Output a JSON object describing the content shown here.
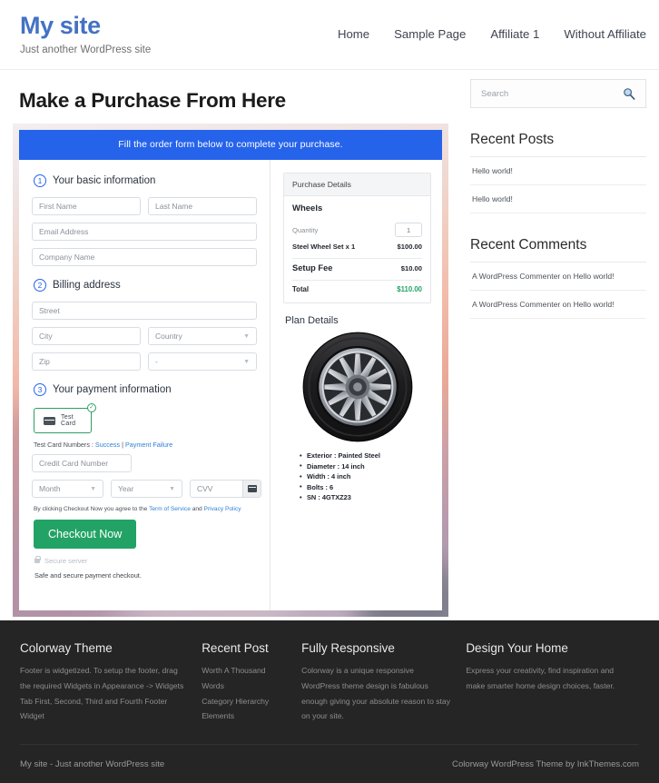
{
  "header": {
    "site_title": "My site",
    "tagline": "Just another WordPress site",
    "nav": [
      {
        "label": "Home"
      },
      {
        "label": "Sample Page"
      },
      {
        "label": "Affiliate 1"
      },
      {
        "label": "Without Affiliate"
      }
    ]
  },
  "main": {
    "page_title": "Make a Purchase From Here",
    "banner": "Fill the order form below to complete your purchase.",
    "steps": {
      "step1_num": "1",
      "step1_label": "Your basic information",
      "step2_num": "2",
      "step2_label": "Billing address",
      "step3_num": "3",
      "step3_label": "Your payment information"
    },
    "fields": {
      "first_name": "First Name",
      "last_name": "Last Name",
      "email": "Email Address",
      "company": "Company Name",
      "street": "Street",
      "city": "City",
      "country": "Country",
      "zip": "Zip",
      "state": "-",
      "card_number": "Credit Card Number",
      "month": "Month",
      "year": "Year",
      "cvv": "CVV"
    },
    "payment": {
      "tile_label": "Test Card",
      "tile_check": "✓",
      "testcard_prefix": "Test Card Numbers : ",
      "testcard_success": "Success",
      "testcard_divider": " | ",
      "testcard_failure": "Payment Failure",
      "agree_prefix": "By clicking Checkout Now you agree to the ",
      "agree_tos": "Term of Service",
      "agree_and": " and ",
      "agree_privacy": "Privacy Policy",
      "checkout_button": "Checkout Now",
      "secure_server": "Secure server",
      "safe_note": "Safe and secure payment checkout."
    },
    "purchase_details": {
      "heading": "Purchase Details",
      "product": "Wheels",
      "quantity_label": "Quantity",
      "quantity_value": "1",
      "item_label": "Steel Wheel Set x 1",
      "item_price": "$100.00",
      "setup_label": "Setup Fee",
      "setup_price": "$10.00",
      "total_label": "Total",
      "total_price": "$110.00",
      "total_color": "#22a365"
    },
    "plan": {
      "title": "Plan Details",
      "image_name": "car-wheel-image",
      "specs": [
        "Exterior : Painted Steel",
        "Diameter : 14 inch",
        "Width : 4 inch",
        "Bolts : 6",
        "SN : 4GTXZ23"
      ]
    }
  },
  "sidebar": {
    "search_placeholder": "Search",
    "recent_posts_title": "Recent Posts",
    "recent_posts": [
      "Hello world!",
      "Hello world!"
    ],
    "recent_comments_title": "Recent Comments",
    "recent_comments": [
      "A WordPress Commenter on Hello world!",
      "A WordPress Commenter on Hello world!"
    ]
  },
  "footer": {
    "columns": [
      {
        "title": "Colorway Theme",
        "text": "Footer is widgetized. To setup the footer, drag the required Widgets in Appearance -> Widgets Tab First, Second, Third and Fourth Footer Widget"
      },
      {
        "title": "Recent Post",
        "links": [
          "Worth A Thousand Words",
          "Category Hierarchy",
          "Elements"
        ]
      },
      {
        "title": "Fully Responsive",
        "text": "Colorway is a unique responsive WordPress theme design is fabulous enough giving your absolute reason to stay on your site."
      },
      {
        "title": "Design Your Home",
        "text": "Express your creativity, find inspiration and make smarter home design choices, faster."
      }
    ],
    "bottom_left": "My site - Just another WordPress site",
    "bottom_right": "Colorway WordPress Theme by InkThemes.com"
  },
  "colors": {
    "brand_blue": "#4372c4",
    "banner_blue": "#2563eb",
    "accent_green": "#22a365",
    "footer_bg": "#252525"
  }
}
